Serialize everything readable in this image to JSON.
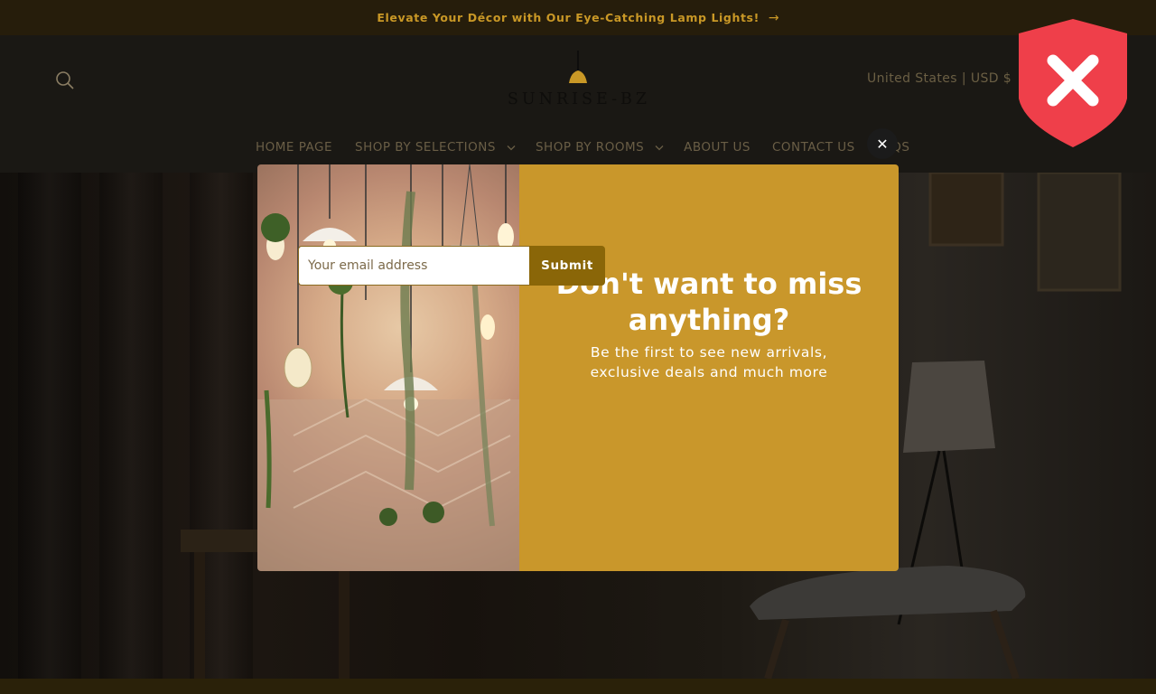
{
  "announcement": {
    "text": "Elevate Your Décor with Our Eye-Catching Lamp Lights!",
    "arrow_icon": "arrow-right-icon"
  },
  "header": {
    "search_icon": "search-icon",
    "logo_text": "SUNRISE-BZ",
    "currency": "United States | USD $"
  },
  "nav": {
    "items": [
      {
        "label": "HOME PAGE",
        "has_dropdown": false
      },
      {
        "label": "SHOP BY SELECTIONS",
        "has_dropdown": true
      },
      {
        "label": "SHOP BY ROOMS",
        "has_dropdown": true
      },
      {
        "label": "ABOUT US",
        "has_dropdown": false
      },
      {
        "label": "CONTACT US",
        "has_dropdown": false
      },
      {
        "label": "FAQS",
        "has_dropdown": false
      }
    ]
  },
  "popup": {
    "heading_line1": "Don't want to miss",
    "heading_line2": "anything?",
    "sub_line1": "Be the first to see new arrivals,",
    "sub_line2": "exclusive deals and much more",
    "email_placeholder": "Your email address",
    "submit_label": "Submit",
    "close_icon": "close-icon"
  },
  "overlay_badge": {
    "icon": "shield-close-icon"
  },
  "colors": {
    "accent": "#c9972b",
    "submit": "#8a6608",
    "announcement_bg": "#261d0b",
    "badge": "#ef3f4a"
  }
}
